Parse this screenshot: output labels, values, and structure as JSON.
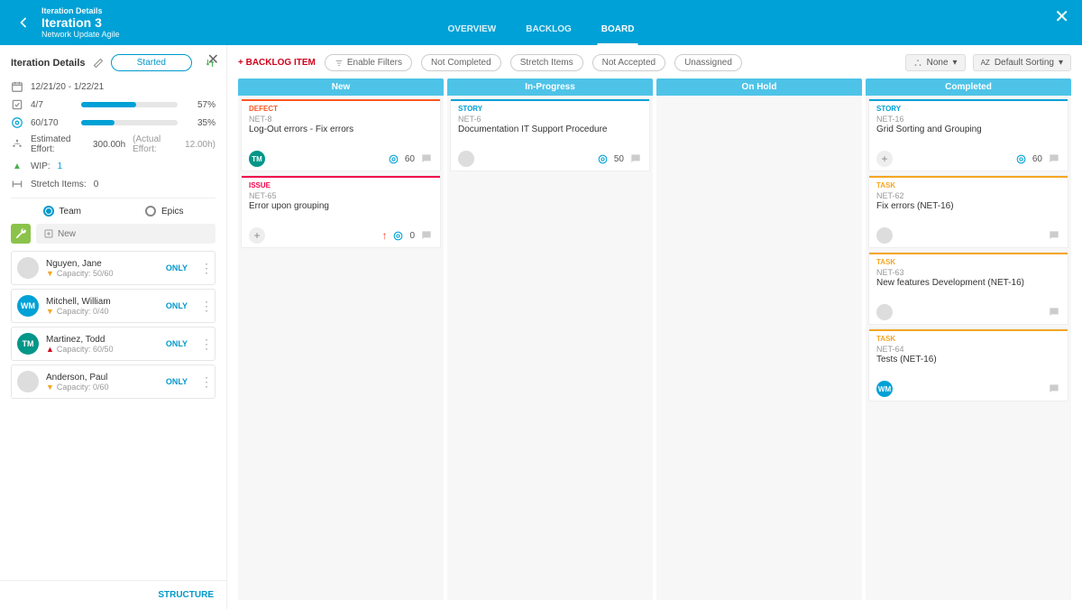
{
  "header": {
    "breadcrumb": "Iteration Details",
    "title": "Iteration 3",
    "subtitle": "Network Update Agile",
    "tabs": {
      "overview": "OVERVIEW",
      "backlog": "BACKLOG",
      "board": "BOARD"
    }
  },
  "sidebar": {
    "title": "Iteration Details",
    "started": "Started",
    "daterange": "12/21/20 - 1/22/21",
    "count": {
      "label": "4/7",
      "pct": "57%",
      "fill": 57
    },
    "points": {
      "label": "60/170",
      "pct": "35%",
      "fill": 35
    },
    "effort": {
      "est_label": "Estimated Effort:",
      "est_val": "300.00h",
      "act_label": "(Actual Effort:",
      "act_val": "12.00h)"
    },
    "wip": {
      "label": "WIP:",
      "val": "1"
    },
    "stretch": {
      "label": "Stretch Items:",
      "val": "0"
    },
    "radio": {
      "team": "Team",
      "epics": "Epics"
    },
    "new": "New",
    "members": [
      {
        "name": "Nguyen, Jane",
        "cap": "Capacity:  50/60",
        "warn": "warn",
        "avatar_bg": "#ddd",
        "avatar_txt": ""
      },
      {
        "name": "Mitchell, William",
        "cap": "Capacity:  0/40",
        "warn": "warn",
        "avatar_bg": "#00a1d6",
        "avatar_txt": "WM"
      },
      {
        "name": "Martinez, Todd",
        "cap": "Capacity:  60/50",
        "warn": "alert",
        "avatar_bg": "#009688",
        "avatar_txt": "TM"
      },
      {
        "name": "Anderson, Paul",
        "cap": "Capacity:  0/60",
        "warn": "warn",
        "avatar_bg": "#ddd",
        "avatar_txt": ""
      }
    ],
    "only": "ONLY",
    "footer": "STRUCTURE"
  },
  "toolbar": {
    "add": "+ BACKLOG ITEM",
    "enable_filters": "Enable Filters",
    "pills": {
      "not_completed": "Not Completed",
      "stretch": "Stretch Items",
      "not_accepted": "Not Accepted",
      "unassigned": "Unassigned"
    },
    "group_none": "None",
    "sort": "Default Sorting"
  },
  "columns": {
    "new": "New",
    "inprogress": "In-Progress",
    "onhold": "On Hold",
    "completed": "Completed"
  },
  "cards": {
    "new": [
      {
        "type": "DEFECT",
        "type_cls": "defect",
        "id": "NET-8",
        "title": "Log-Out errors - Fix errors",
        "avatar_bg": "#009688",
        "avatar_txt": "TM",
        "points": "60",
        "chat_badge": true
      },
      {
        "type": "ISSUE",
        "type_cls": "issue",
        "id": "NET-65",
        "title": "Error upon grouping",
        "avatar_plus": true,
        "points": "0",
        "prio": true
      }
    ],
    "inprogress": [
      {
        "type": "STORY",
        "type_cls": "story",
        "id": "NET-6",
        "title": "Documentation IT Support Procedure",
        "avatar_bg": "#ddd",
        "avatar_txt": "",
        "points": "50",
        "chat_badge": true
      }
    ],
    "completed": [
      {
        "type": "STORY",
        "type_cls": "story",
        "id": "NET-16",
        "title": "Grid Sorting and Grouping",
        "avatar_plus": true,
        "points": "60"
      },
      {
        "type": "TASK",
        "type_cls": "task",
        "id": "NET-62",
        "title": "Fix errors (NET-16)",
        "avatar_bg": "#ddd",
        "avatar_txt": ""
      },
      {
        "type": "TASK",
        "type_cls": "task",
        "id": "NET-63",
        "title": "New features Development (NET-16)",
        "avatar_bg": "#ddd",
        "avatar_txt": ""
      },
      {
        "type": "TASK",
        "type_cls": "task",
        "id": "NET-64",
        "title": "Tests (NET-16)",
        "avatar_bg": "#00a1d6",
        "avatar_txt": "WM"
      }
    ]
  }
}
